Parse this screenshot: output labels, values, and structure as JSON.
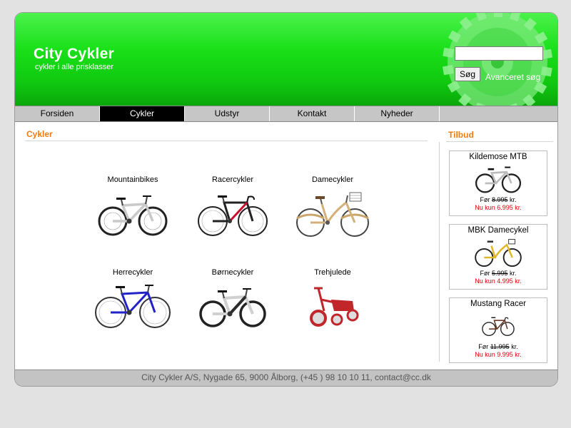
{
  "brand": {
    "title": "City Cykler",
    "tagline": "cykler i alle prisklasser"
  },
  "search": {
    "value": "",
    "button_label": "Søg",
    "advanced_link": "Avanceret søg"
  },
  "nav": [
    {
      "label": "Forsiden",
      "active": false
    },
    {
      "label": "Cykler",
      "active": true
    },
    {
      "label": "Udstyr",
      "active": false
    },
    {
      "label": "Kontakt",
      "active": false
    },
    {
      "label": "Nyheder",
      "active": false
    }
  ],
  "main": {
    "title": "Cykler",
    "categories": [
      {
        "label": "Mountainbikes",
        "icon": "mountainbike-image"
      },
      {
        "label": "Racercykler",
        "icon": "racer-bike-image"
      },
      {
        "label": "Damecykler",
        "icon": "ladies-bike-image"
      },
      {
        "label": "Herrecykler",
        "icon": "mens-bike-image"
      },
      {
        "label": "Børnecykler",
        "icon": "kids-bike-image"
      },
      {
        "label": "Trehjulede",
        "icon": "tricycle-image"
      }
    ]
  },
  "sidebar": {
    "title": "Tilbud",
    "offers": [
      {
        "name": "Kildemose MTB",
        "before_prefix": "Før",
        "before_price": "8.995",
        "before_suffix": "kr.",
        "now": "Nu kun 6.995 kr."
      },
      {
        "name": "MBK Damecykel",
        "before_prefix": "Før",
        "before_price": "5.995",
        "before_suffix": "kr.",
        "now": "Nu kun 4.995 kr."
      },
      {
        "name": "Mustang Racer",
        "before_prefix": "Før",
        "before_price": "11.995",
        "before_suffix": "kr.",
        "now": "Nu kun 9.995 kr."
      }
    ]
  },
  "footer": {
    "text": "City Cykler A/S, Nygade 65, 9000 Ålborg, (+45 ) 98 10 10 11, contact@cc.dk"
  },
  "colors": {
    "header_green": "#19e019",
    "accent_orange": "#f07c10",
    "sale_red": "#e0000b",
    "nav_active": "#000000"
  }
}
